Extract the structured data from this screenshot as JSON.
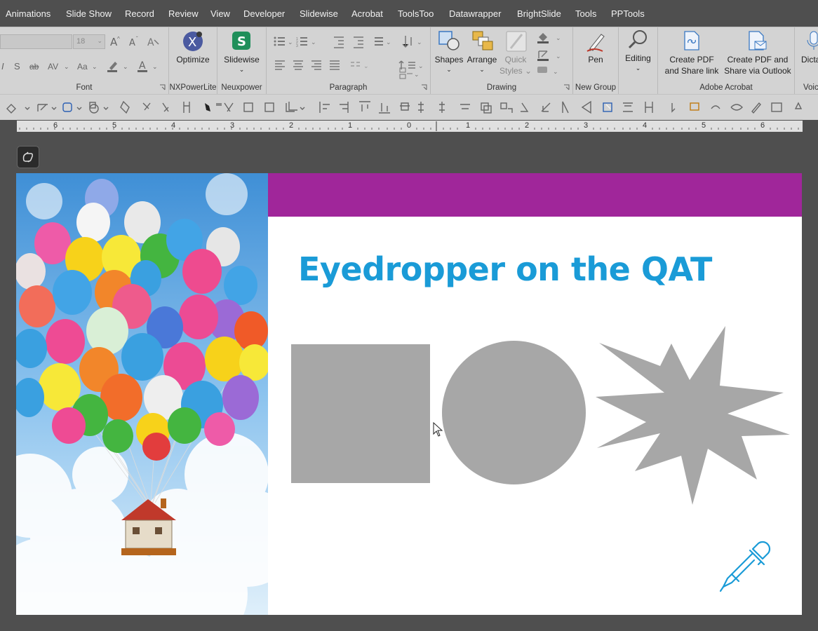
{
  "menu": [
    "Animations",
    "Slide Show",
    "Record",
    "Review",
    "View",
    "Developer",
    "Slidewise",
    "Acrobat",
    "ToolsToo",
    "Datawrapper",
    "BrightSlide",
    "Tools",
    "PPTools"
  ],
  "ribbon": {
    "font": {
      "size": "18",
      "label": "Font"
    },
    "nxpowerlite": {
      "button": "Optimize",
      "label": "NXPowerLite"
    },
    "neuxpower": {
      "button": "Slidewise",
      "label": "Neuxpower"
    },
    "paragraph": {
      "label": "Paragraph"
    },
    "drawing": {
      "shapes": "Shapes",
      "arrange": "Arrange",
      "quick_styles_1": "Quick",
      "quick_styles_2": "Styles",
      "label": "Drawing"
    },
    "new_group": {
      "pen": "Pen",
      "label": "New Group"
    },
    "editing": {
      "button": "Editing"
    },
    "acrobat": {
      "btn1_line1": "Create PDF",
      "btn1_line2": "and Share link",
      "btn2_line1": "Create PDF and",
      "btn2_line2": "Share via Outlook",
      "label": "Adobe Acrobat"
    },
    "voice": {
      "button": "Dicta",
      "label": "Voic"
    }
  },
  "ruler": {
    "ticks": [
      "6",
      "5",
      "4",
      "3",
      "2",
      "1",
      "0",
      "1",
      "2",
      "3",
      "4",
      "5",
      "6"
    ]
  },
  "slide": {
    "title": "Eyedropper on the QAT"
  },
  "colors": {
    "accent_band": "#a0269a",
    "title": "#1a9bd7",
    "shape_fill": "#a7a7a7",
    "eyedropper": "#1a9bd7"
  }
}
